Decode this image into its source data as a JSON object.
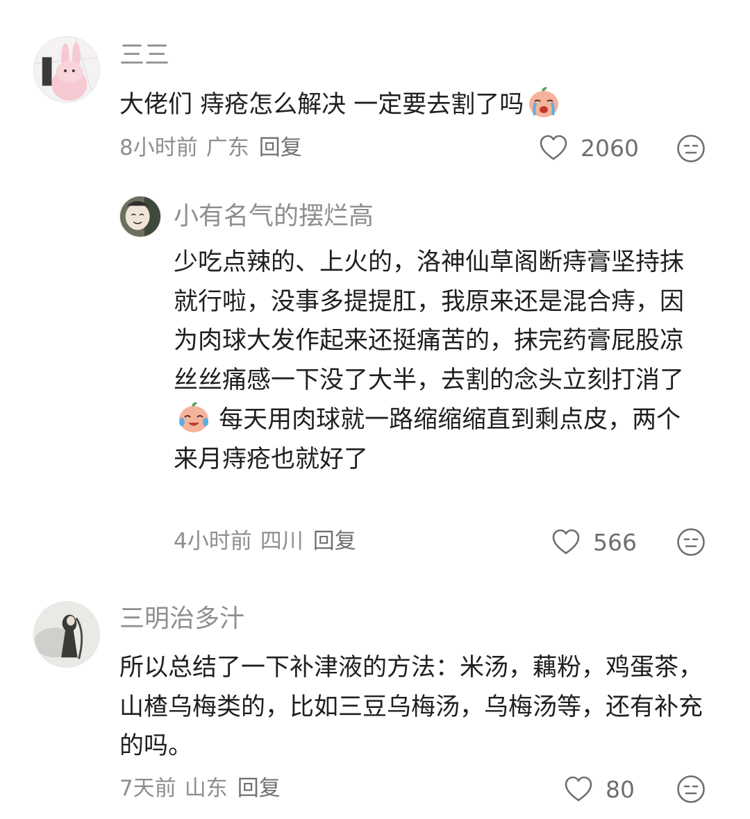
{
  "comments": [
    {
      "username": "三三",
      "text": "大佬们 痔疮怎么解决 一定要去割了吗",
      "emoji": "crying-face-emoji",
      "time": "8小时前",
      "location": "广东",
      "reply_label": "回复",
      "likes": "2060",
      "replies": [
        {
          "username": "小有名气的摆烂高",
          "text_part1": "少吃点辣的、上火的，洛神仙草阁断痔膏坚持抹就行啦，没事多提提肛，我原来还是混合痔，因为肉球大发作起来还挺痛苦的，抹完药膏屁股凉丝丝痛感一下没了大半，去割的念头立刻打消了",
          "emoji": "crying-laughing-face-emoji",
          "text_part2": " 每天用肉球就一路缩缩缩直到剩点皮，两个来月痔疮也就好了",
          "time": "4小时前",
          "location": "四川",
          "reply_label": "回复",
          "likes": "566"
        }
      ]
    },
    {
      "username": "三明治多汁",
      "text": "所以总结了一下补津液的方法：米汤，藕粉，鸡蛋茶，山楂乌梅类的，比如三豆乌梅汤，乌梅汤等，还有补充的吗。",
      "time": "7天前",
      "location": "山东",
      "reply_label": "回复",
      "likes": "80"
    }
  ],
  "icons": {
    "like": "heart-outline-icon",
    "dislike": "neutral-face-icon"
  },
  "colors": {
    "text": "#1f1f1f",
    "muted": "#8e8e8e",
    "background": "#ffffff"
  }
}
